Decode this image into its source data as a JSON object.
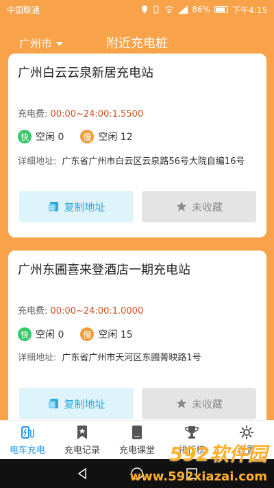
{
  "status_bar": {
    "carrier": "中国联通",
    "battery": "86%",
    "time": "下午4:15"
  },
  "header": {
    "city": "广州市",
    "title": "附近充电桩"
  },
  "stations": [
    {
      "name": "广州白云云泉新居充电站",
      "fee_label": "充电费:",
      "fee_value": "00:00~24:00:1.5500",
      "fast_badge": "快",
      "fast_text": "空闲 0",
      "slow_badge": "慢",
      "slow_text": "空闲 12",
      "address_label": "详细地址:",
      "address": "广东省广州市白云区云泉路56号大院自编16号",
      "copy_label": "复制地址",
      "fav_label": "未收藏"
    },
    {
      "name": "广州东圃喜来登酒店一期充电站",
      "fee_label": "充电费:",
      "fee_value": "00:00~24:00:1.0000",
      "fast_badge": "快",
      "fast_text": "空闲 0",
      "slow_badge": "慢",
      "slow_text": "空闲 15",
      "address_label": "详细地址:",
      "address": "广东省广州市天河区东圃菁映路1号",
      "copy_label": "复制地址",
      "fav_label": "未收藏"
    }
  ],
  "bottom_nav": [
    {
      "label": "电车充电",
      "icon": "charging-plug-icon",
      "active": true
    },
    {
      "label": "充电记录",
      "icon": "bookmark-icon",
      "active": false
    },
    {
      "label": "充电课堂",
      "icon": "book-icon",
      "active": false
    },
    {
      "label": "排行榜",
      "icon": "trophy-icon",
      "active": false
    },
    {
      "label": "设置",
      "icon": "gear-icon",
      "active": false
    }
  ],
  "watermark": {
    "brand": "592软件园",
    "url": "www.592xiazai.com"
  },
  "colors": {
    "header_bg": "#f8a24a",
    "accent_blue": "#2196f3",
    "fee_red": "#d24a1b",
    "fast_green": "#3cc66a",
    "slow_orange": "#f59b3a"
  }
}
